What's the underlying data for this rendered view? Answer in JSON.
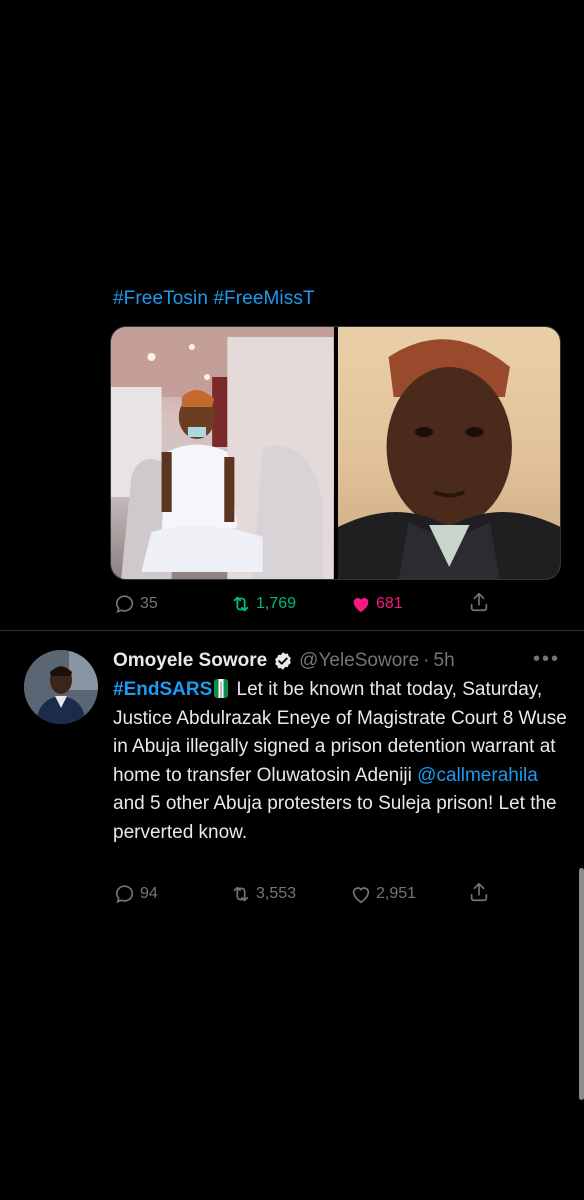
{
  "first_tweet": {
    "text": "#FreeTosin #FreeMissT",
    "stats": {
      "replies": "35",
      "retweets": "1,769",
      "likes": "681"
    }
  },
  "second_tweet": {
    "author_name": "Omoyele Sowore",
    "handle": "@YeleSowore",
    "separator": "·",
    "time": "5h",
    "hashtag": "#EndSARS",
    "text_part1": "Let it be known that today, Saturday, Justice Abdulrazak Eneye of Magistrate Court 8 Wuse in Abuja illegally signed a prison detention warrant at home to transfer  Oluwatosin Adeniji",
    "mention": "@callmerahila",
    "text_part2": "and 5 other Abuja protesters to Suleja prison! Let the perverted know.",
    "stats": {
      "replies": "94",
      "retweets": "3,553",
      "likes": "2,951"
    }
  },
  "icons": {
    "reply": "reply-icon",
    "retweet": "retweet-icon",
    "like": "heart-icon",
    "share": "share-icon",
    "verified": "verified-badge-icon",
    "more": "more-icon",
    "flag": "nigeria-flag-icon"
  },
  "colors": {
    "background": "#000000",
    "link": "#1d9bf0",
    "retweet_active": "#00ba7c",
    "like_active": "#f91880",
    "muted": "#71767b"
  }
}
